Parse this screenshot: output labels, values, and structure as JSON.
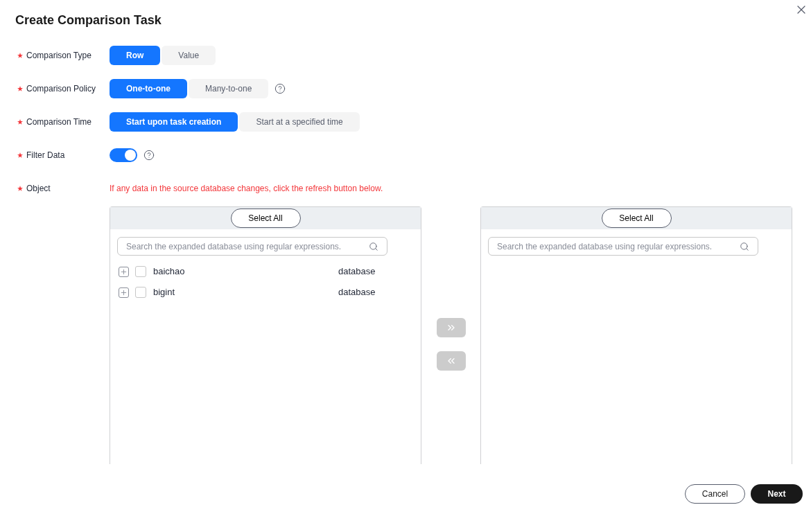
{
  "dialog": {
    "title": "Create Comparison Task"
  },
  "fields": [
    {
      "label": "Comparison Type",
      "required": true,
      "kind": "segmented",
      "options": [
        {
          "label": "Row",
          "selected": true
        },
        {
          "label": "Value",
          "selected": false
        }
      ]
    },
    {
      "label": "Comparison Policy",
      "required": true,
      "kind": "segmented",
      "help": true,
      "options": [
        {
          "label": "One-to-one",
          "selected": true
        },
        {
          "label": "Many-to-one",
          "selected": false
        }
      ]
    },
    {
      "label": "Comparison Time",
      "required": true,
      "kind": "segmented",
      "options": [
        {
          "label": "Start upon task creation",
          "selected": true
        },
        {
          "label": "Start at a specified time",
          "selected": false
        }
      ]
    },
    {
      "label": "Filter Data",
      "required": true,
      "kind": "switch",
      "help": true,
      "on": true
    },
    {
      "label": "Object",
      "required": true,
      "kind": "note",
      "note": "If any data in the source database changes, click the refresh button below."
    }
  ],
  "source_panel": {
    "select_all": "Select All",
    "search_placeholder": "Search the expanded database using regular expressions.",
    "items": [
      {
        "name": "baichao",
        "type": "database",
        "checked": false,
        "expanded": false
      },
      {
        "name": "bigint",
        "type": "database",
        "checked": false,
        "expanded": false
      }
    ]
  },
  "target_panel": {
    "select_all": "Select All",
    "search_placeholder": "Search the expanded database using regular expressions."
  },
  "transfer": {
    "add_disabled": true,
    "remove_disabled": true
  },
  "footer": {
    "cancel": "Cancel",
    "next": "Next"
  }
}
